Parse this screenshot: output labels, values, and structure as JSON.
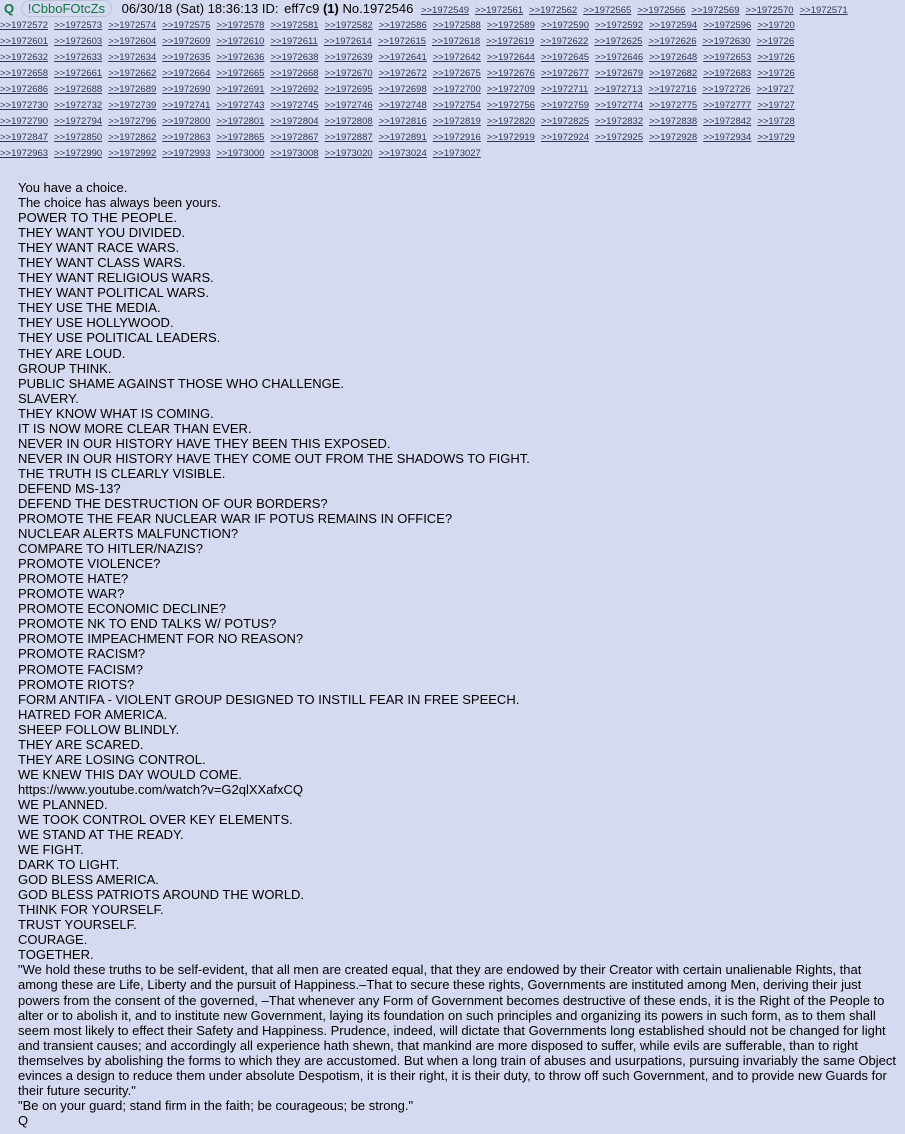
{
  "header": {
    "name": "Q",
    "tripcode": "!CbboFOtcZs",
    "date": "06/30/18 (Sat) 18:36:13",
    "id_label": "ID:",
    "id_value": "eff7c9",
    "id_count": "(1)",
    "post_number": "No.1972546",
    "inline_replies": [
      ">>1972549",
      ">>1972561",
      ">>1972562",
      ">>1972565",
      ">>1972566",
      ">>1972569",
      ">>1972570",
      ">>1972571"
    ]
  },
  "reply_rows": [
    [
      ">>1972572",
      ">>1972573",
      ">>1972574",
      ">>1972575",
      ">>1972578",
      ">>1972581",
      ">>1972582",
      ">>1972586",
      ">>1972588",
      ">>1972589",
      ">>1972590",
      ">>1972592",
      ">>1972594",
      ">>1972596",
      ">>19720"
    ],
    [
      ">>1972601",
      ">>1972603",
      ">>1972604",
      ">>1972609",
      ">>1972610",
      ">>1972611",
      ">>1972614",
      ">>1972615",
      ">>1972618",
      ">>1972619",
      ">>1972622",
      ">>1972625",
      ">>1972626",
      ">>1972630",
      ">>19726"
    ],
    [
      ">>1972632",
      ">>1972633",
      ">>1972634",
      ">>1972635",
      ">>1972636",
      ">>1972638",
      ">>1972639",
      ">>1972641",
      ">>1972642",
      ">>1972644",
      ">>1972645",
      ">>1972646",
      ">>1972648",
      ">>1972653",
      ">>19726"
    ],
    [
      ">>1972658",
      ">>1972661",
      ">>1972662",
      ">>1972664",
      ">>1972665",
      ">>1972668",
      ">>1972670",
      ">>1972672",
      ">>1972675",
      ">>1972676",
      ">>1972677",
      ">>1972679",
      ">>1972682",
      ">>1972683",
      ">>19726"
    ],
    [
      ">>1972686",
      ">>1972688",
      ">>1972689",
      ">>1972690",
      ">>1972691",
      ">>1972692",
      ">>1972695",
      ">>1972698",
      ">>1972700",
      ">>1972709",
      ">>1972711",
      ">>1972713",
      ">>1972716",
      ">>1972726",
      ">>19727"
    ],
    [
      ">>1972730",
      ">>1972732",
      ">>1972739",
      ">>1972741",
      ">>1972743",
      ">>1972745",
      ">>1972746",
      ">>1972748",
      ">>1972754",
      ">>1972756",
      ">>1972759",
      ">>1972774",
      ">>1972775",
      ">>1972777",
      ">>19727"
    ],
    [
      ">>1972790",
      ">>1972794",
      ">>1972796",
      ">>1972800",
      ">>1972801",
      ">>1972804",
      ">>1972808",
      ">>1972816",
      ">>1972819",
      ">>1972820",
      ">>1972825",
      ">>1972832",
      ">>1972838",
      ">>1972842",
      ">>19728"
    ],
    [
      ">>1972847",
      ">>1972850",
      ">>1972862",
      ">>1972863",
      ">>1972865",
      ">>1972867",
      ">>1972887",
      ">>1972891",
      ">>1972916",
      ">>1972919",
      ">>1972924",
      ">>1972925",
      ">>1972928",
      ">>1972934",
      ">>19729"
    ],
    [
      ">>1972963",
      ">>1972990",
      ">>1972992",
      ">>1972993",
      ">>1973000",
      ">>1973008",
      ">>1973020",
      ">>1973024",
      ">>1973027"
    ]
  ],
  "body_lines": [
    "You have a choice.",
    "The choice has always been yours.",
    "POWER TO THE PEOPLE.",
    "THEY WANT YOU DIVIDED.",
    "THEY WANT RACE WARS.",
    "THEY WANT CLASS WARS.",
    "THEY WANT RELIGIOUS WARS.",
    "THEY WANT POLITICAL WARS.",
    "THEY USE THE MEDIA.",
    "THEY USE HOLLYWOOD.",
    "THEY USE POLITICAL LEADERS.",
    "THEY ARE LOUD.",
    "GROUP THINK.",
    "PUBLIC SHAME AGAINST THOSE WHO CHALLENGE.",
    "SLAVERY.",
    "THEY KNOW WHAT IS COMING.",
    "IT IS NOW MORE CLEAR THAN EVER.",
    "NEVER IN OUR HISTORY HAVE THEY BEEN THIS EXPOSED.",
    "NEVER IN OUR HISTORY HAVE THEY COME OUT FROM THE SHADOWS TO FIGHT.",
    "THE TRUTH IS CLEARLY VISIBLE.",
    "DEFEND MS-13?",
    "DEFEND THE DESTRUCTION OF OUR BORDERS?",
    "PROMOTE THE FEAR NUCLEAR WAR IF POTUS REMAINS IN OFFICE?",
    "NUCLEAR ALERTS MALFUNCTION?",
    "COMPARE TO HITLER/NAZIS?",
    "PROMOTE VIOLENCE?",
    "PROMOTE HATE?",
    "PROMOTE WAR?",
    "PROMOTE ECONOMIC DECLINE?",
    "PROMOTE NK TO END TALKS W/ POTUS?",
    "PROMOTE IMPEACHMENT FOR NO REASON?",
    "PROMOTE RACISM?",
    "PROMOTE FACISM?",
    "PROMOTE RIOTS?",
    "FORM ANTIFA - VIOLENT GROUP DESIGNED TO INSTILL FEAR IN FREE SPEECH.",
    "HATRED FOR AMERICA.",
    "SHEEP FOLLOW BLINDLY.",
    "THEY ARE SCARED.",
    "THEY ARE LOSING CONTROL.",
    "WE KNEW THIS DAY WOULD COME."
  ],
  "link": "https://www.youtube.com/watch?v=G2qlXXafxCQ",
  "body_lines_2": [
    "WE PLANNED.",
    "WE TOOK CONTROL OVER KEY ELEMENTS.",
    "WE STAND AT THE READY.",
    "WE FIGHT.",
    "DARK TO LIGHT.",
    "GOD BLESS AMERICA.",
    "GOD BLESS PATRIOTS AROUND THE WORLD.",
    "THINK FOR YOURSELF.",
    "TRUST YOURSELF.",
    "COURAGE.",
    "TOGETHER."
  ],
  "quote_paragraph": "\"We hold these truths to be self-evident, that all men are created equal, that they are endowed by their Creator with certain unalienable Rights, that among these are Life, Liberty and the pursuit of Happiness.–That to secure these rights, Governments are instituted among Men, deriving their just powers from the consent of the governed, –That whenever any Form of Government becomes destructive of these ends, it is the Right of the People to alter or to abolish it, and to institute new Government, laying its foundation on such principles and organizing its powers in such form, as to them shall seem most likely to effect their Safety and Happiness. Prudence, indeed, will dictate that Governments long established should not be changed for light and transient causes; and accordingly all experience hath shewn, that mankind are more disposed to suffer, while evils are sufferable, than to right themselves by abolishing the forms to which they are accustomed. But when a long train of abuses and usurpations, pursuing invariably the same Object evinces a design to reduce them under absolute Despotism, it is their right, it is their duty, to throw off such Government, and to provide new Guards for their future security.\"",
  "closing_quote": "\"Be on your guard; stand firm in the faith; be courageous; be strong.\"",
  "signature": "Q",
  "colors": {
    "background": "#d6daf0",
    "name": "#117743",
    "reply_link": "#34345c",
    "text": "#000000"
  }
}
